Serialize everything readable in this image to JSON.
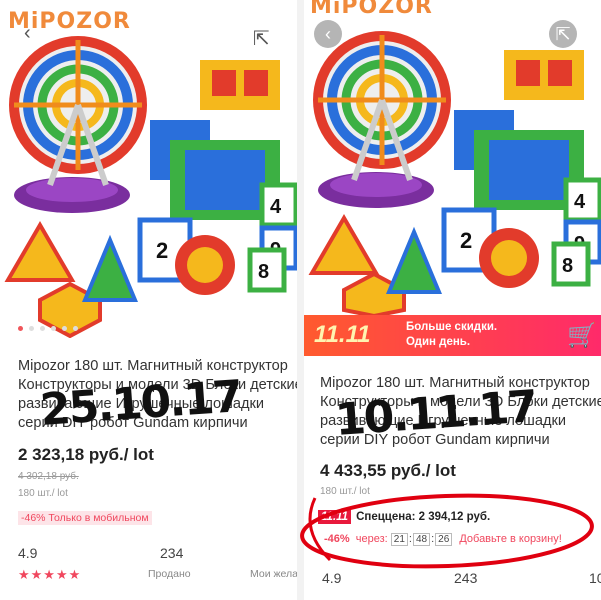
{
  "colors": {
    "accent": "#f0475e",
    "sale_gradient_start": "#ff5a2e",
    "sale_gradient_end": "#ff2a6a",
    "annotation": "#e00010",
    "brand": "#f08a3b"
  },
  "left": {
    "brand": "MiPOZOR",
    "title": "Mipozor 180 шт. Магнитный конструктор Конструкторы и модели 3D Блоки детские развивающие Игрушечные лошадки серии DIY робот Gundam кирпичи",
    "price": "2 323,18 руб./ lot",
    "old_price": "4 302,18 руб.",
    "lot_size": "180 шт./ lot",
    "mobile_discount": "-46% Только в мобильном",
    "rating": "4.9",
    "sold_count": "234",
    "sold_label": "Продано",
    "wish_label": "Мои жела",
    "overlay_date": "25.10.17",
    "icons": {
      "back": "chevron-left-icon",
      "share": "share-icon"
    }
  },
  "right": {
    "brand": "MiPOZOR",
    "sale_badge": "11.11",
    "sale_line1": "Больше скидки.",
    "sale_line2": "Один день.",
    "title": "Mipozor 180 шт. Магнитный конструктор Конструкторы и модели 3D Блоки детские развивающие Игрушечные лошадки серии DIY робот Gundam кирпичи",
    "price": "4 433,55 руб./ lot",
    "lot_size": "180 шт./ lot",
    "special_badge": "11.11",
    "special_price": "Спеццена: 2 394,12 руб.",
    "discount": "-46%",
    "timer_label": "через:",
    "timer_h": "21",
    "timer_m": "48",
    "timer_s": "26",
    "cta": "Добавьте в корзину!",
    "rating": "4.9",
    "sold_count": "243",
    "edge_number": "10",
    "overlay_date": "10.11.17",
    "icons": {
      "back": "chevron-left-icon",
      "share": "share-icon",
      "cart": "cart-icon"
    }
  }
}
